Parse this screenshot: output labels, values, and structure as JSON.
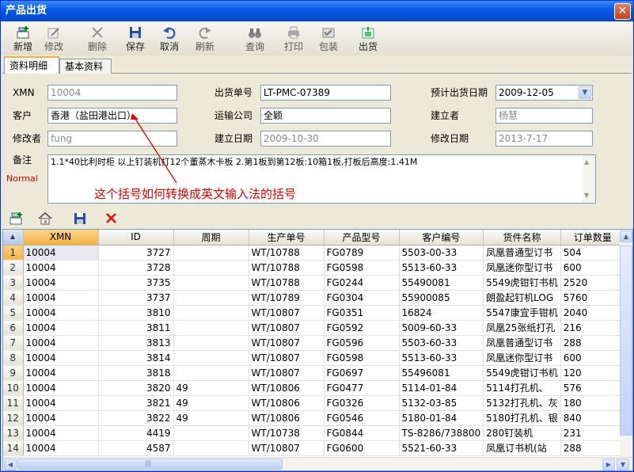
{
  "window": {
    "title": "产品出货",
    "close_glyph": "✕"
  },
  "toolbar": [
    {
      "key": "new",
      "label": "新增",
      "icon": "new-icon",
      "enabled": true
    },
    {
      "key": "edit",
      "label": "修改",
      "icon": "edit-icon",
      "enabled": false
    },
    {
      "key": "delete",
      "label": "删除",
      "icon": "delete-icon",
      "enabled": false
    },
    {
      "key": "save",
      "label": "保存",
      "icon": "save-icon",
      "enabled": true
    },
    {
      "key": "cancel",
      "label": "取消",
      "icon": "undo-icon",
      "enabled": true
    },
    {
      "key": "refresh",
      "label": "刷新",
      "icon": "redo-icon",
      "enabled": false
    },
    {
      "key": "query",
      "label": "查询",
      "icon": "binoculars-icon",
      "enabled": false
    },
    {
      "key": "print",
      "label": "打印",
      "icon": "printer-icon",
      "enabled": false
    },
    {
      "key": "pack",
      "label": "包装",
      "icon": "pack-icon",
      "enabled": false
    },
    {
      "key": "ship",
      "label": "出货",
      "icon": "ship-icon",
      "enabled": true
    }
  ],
  "tabs": [
    {
      "label": "资料明细",
      "active": true
    },
    {
      "label": "基本资料",
      "active": false
    }
  ],
  "form": {
    "xmn_label": "XMN",
    "xmn_value": "10004",
    "ship_no_label": "出货单号",
    "ship_no_value": "LT-PMC-07389",
    "plan_date_label": "预计出货日期",
    "plan_date_value": "2009-12-05",
    "customer_label": "客户",
    "customer_value": "香港（盐田港出口）",
    "transport_label": "运输公司",
    "transport_value": "全颖",
    "creator_label": "建立者",
    "creator_value": "杨慧",
    "modifier_label": "修改者",
    "modifier_value": "fung",
    "create_date_label": "建立日期",
    "create_date_value": "2009-10-30",
    "modify_date_label": "修改日期",
    "modify_date_value": "2013-7-17",
    "remark_label": "备注",
    "remark_value": "1.1*40比利时柜 以上钉装机打12个董蒸木卡板  2.第1板到第12板:10箱1板,打板后高度:1.41M",
    "normal_label": "Normal"
  },
  "annotation": "这个括号如何转换成英文输入法的括号",
  "grid": {
    "columns": [
      "XMN",
      "ID",
      "周期",
      "生产单号",
      "产品型号",
      "客户编号",
      "货件名称",
      "订单数量"
    ],
    "rows": [
      [
        "1",
        "10004",
        "3727",
        "",
        "WT/10788",
        "FG0789",
        "5503-00-33",
        "凤凰普通型订书",
        "504"
      ],
      [
        "2",
        "10004",
        "3728",
        "",
        "WT/10788",
        "FG0598",
        "5513-60-33",
        "凤凰迷你型订书",
        "600"
      ],
      [
        "3",
        "10004",
        "3735",
        "",
        "WT/10788",
        "FG0244",
        "55490081",
        "5549虎钳钉书机",
        "2520"
      ],
      [
        "4",
        "10004",
        "3737",
        "",
        "WT/10789",
        "FG0304",
        "55900085",
        "朗盈起钉机LOG",
        "5760"
      ],
      [
        "5",
        "10004",
        "3810",
        "",
        "WT/10807",
        "FG0351",
        "16824",
        "5547康宜手钳机",
        "2040"
      ],
      [
        "6",
        "10004",
        "3811",
        "",
        "WT/10807",
        "FG0592",
        "5009-60-33",
        "凤凰25张纸打孔",
        "216"
      ],
      [
        "7",
        "10004",
        "3813",
        "",
        "WT/10807",
        "FG0596",
        "5503-60-33",
        "凤凰普通型订书",
        "288"
      ],
      [
        "8",
        "10004",
        "3814",
        "",
        "WT/10807",
        "FG0598",
        "5513-60-33",
        "凤凰迷你型订书",
        "600"
      ],
      [
        "9",
        "10004",
        "3818",
        "",
        "WT/10807",
        "FG0697",
        "55496081",
        "5549虎钳订书机",
        "120"
      ],
      [
        "10",
        "10004",
        "3820",
        "49",
        "WT/10806",
        "FG0477",
        "5114-01-84",
        "5114打孔机、",
        "576"
      ],
      [
        "11",
        "10004",
        "3821",
        "49",
        "WT/10806",
        "FG0326",
        "5132-03-85",
        "5132打孔机、灰",
        "180"
      ],
      [
        "12",
        "10004",
        "3822",
        "49",
        "WT/10806",
        "FG0546",
        "5180-01-84",
        "5180打孔机、银",
        "840"
      ],
      [
        "13",
        "10004",
        "4419",
        "",
        "WT/10738",
        "FG0844",
        "TS-8286/738800",
        "280钉装机",
        "231"
      ],
      [
        "14",
        "10004",
        "4587",
        "",
        "WT/10807",
        "FG0600",
        "5521-60-33",
        "凤凰订书机(站",
        "288"
      ]
    ]
  },
  "scroll_glyphs": {
    "left": "◀",
    "right": "▶",
    "up": "▲",
    "down": "▼",
    "grip": "|||",
    "combo": "▼"
  }
}
